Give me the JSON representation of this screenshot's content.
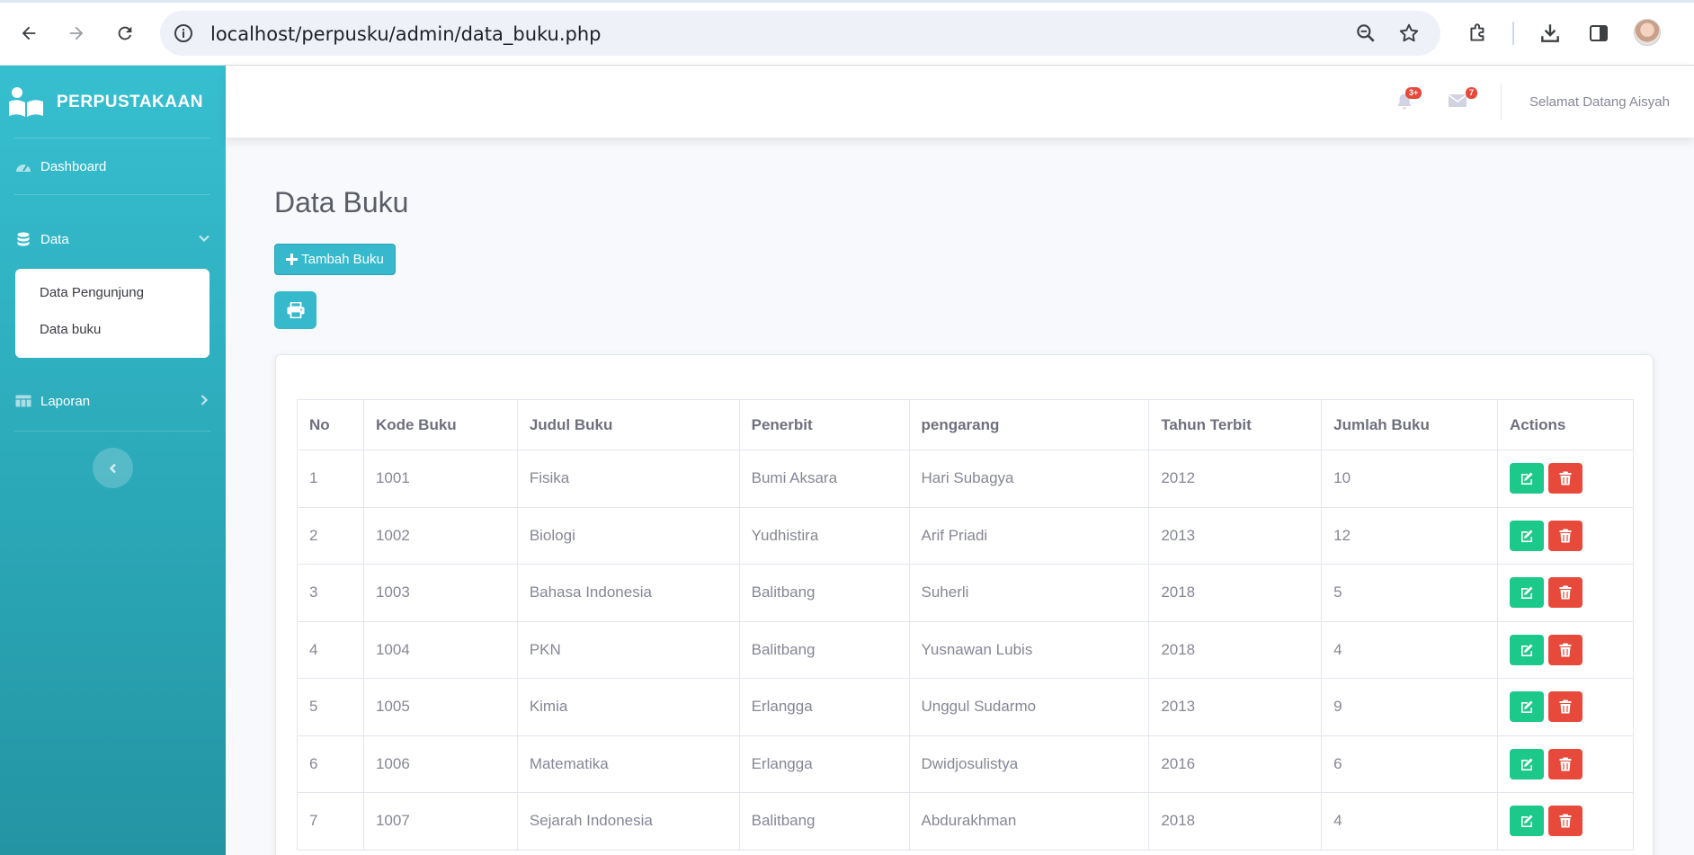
{
  "browser": {
    "url": "localhost/perpusku/admin/data_buku.php"
  },
  "sidebar": {
    "brand": "PERPUSTAKAAN",
    "dashboard_label": "Dashboard",
    "data_label": "Data",
    "submenu": [
      "Data Pengunjung",
      "Data buku"
    ],
    "laporan_label": "Laporan"
  },
  "topbar": {
    "alerts_badge": "3+",
    "messages_badge": "7",
    "welcome": "Selamat Datang Aisyah"
  },
  "main": {
    "title": "Data Buku",
    "add_button": "Tambah Buku"
  },
  "table": {
    "headers": [
      "No",
      "Kode Buku",
      "Judul Buku",
      "Penerbit",
      "pengarang",
      "Tahun Terbit",
      "Jumlah Buku",
      "Actions"
    ],
    "rows": [
      [
        "1",
        "1001",
        "Fisika",
        "Bumi Aksara",
        "Hari Subagya",
        "2012",
        "10"
      ],
      [
        "2",
        "1002",
        "Biologi",
        "Yudhistira",
        "Arif Priadi",
        "2013",
        "12"
      ],
      [
        "3",
        "1003",
        "Bahasa Indonesia",
        "Balitbang",
        "Suherli",
        "2018",
        "5"
      ],
      [
        "4",
        "1004",
        "PKN",
        "Balitbang",
        "Yusnawan Lubis",
        "2018",
        "4"
      ],
      [
        "5",
        "1005",
        "Kimia",
        "Erlangga",
        "Unggul Sudarmo",
        "2013",
        "9"
      ],
      [
        "6",
        "1006",
        "Matematika",
        "Erlangga",
        "Dwidjosulistya",
        "2016",
        "6"
      ],
      [
        "7",
        "1007",
        "Sejarah Indonesia",
        "Balitbang",
        "Abdurakhman",
        "2018",
        "4"
      ]
    ]
  },
  "colors": {
    "sidebar": "#36b9cc",
    "edit": "#1cc88a",
    "delete": "#e74a3b"
  }
}
